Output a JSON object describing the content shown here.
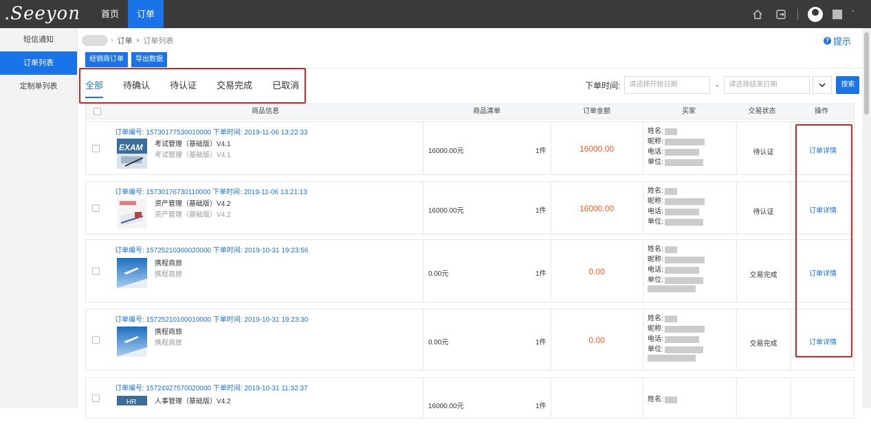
{
  "header": {
    "logo_text": ".Seeyon",
    "nav": [
      {
        "label": "首页",
        "active": false
      },
      {
        "label": "订单",
        "active": true
      }
    ]
  },
  "sidebar": {
    "items": [
      {
        "label": "短信通知",
        "active": false
      },
      {
        "label": "订单列表",
        "active": true
      },
      {
        "label": "定制单列表",
        "active": false
      }
    ]
  },
  "breadcrumb": {
    "parent": "订单",
    "separator": "›",
    "current": "订单列表"
  },
  "help_label": "提示",
  "actions": {
    "dealer_order": "经销商订单",
    "export": "导出数据"
  },
  "tabs": [
    {
      "label": "全部",
      "active": true
    },
    {
      "label": "待确认",
      "active": false
    },
    {
      "label": "待认证",
      "active": false
    },
    {
      "label": "交易完成",
      "active": false
    },
    {
      "label": "已取消",
      "active": false
    }
  ],
  "filter": {
    "label": "下单时间:",
    "start_placeholder": "请选择开始日期",
    "dash": "-",
    "end_placeholder": "请选择结束日期",
    "search_label": "搜索"
  },
  "table": {
    "columns": [
      "商品信息",
      "商品清单",
      "订单金额",
      "买家",
      "交易状态",
      "操作"
    ]
  },
  "buyer_labels": {
    "name": "姓名:",
    "nick": "昵称:",
    "phone": "电话:",
    "unit": "单位:"
  },
  "orders": [
    {
      "header": "订单编号: 15730177530010000 下单时间: 2019-11-06 13:22:33",
      "product": "考试管理（基础版）V4.1",
      "product_sub": "考试管理（基础版）V4.1",
      "price": "16000.00元",
      "qty": "1件",
      "amount": "16000.00",
      "status": "待认证",
      "action": "订单详情",
      "thumb": "exam"
    },
    {
      "header": "订单编号: 15730176730110000 下单时间: 2019-11-06 13:21:13",
      "product": "资产管理（基础版）V4.2",
      "product_sub": "资产管理（基础版）V4.2",
      "price": "16000.00元",
      "qty": "1件",
      "amount": "16000.00",
      "status": "待认证",
      "action": "订单详情",
      "thumb": "asset"
    },
    {
      "header": "订单编号: 15725210360020000 下单时间: 2019-10-31 19:23:56",
      "product": "携程商旅",
      "product_sub": "携程商旅",
      "price": "0.00元",
      "qty": "1件",
      "amount": "0.00",
      "status": "交易完成",
      "action": "订单详情",
      "thumb": "travel"
    },
    {
      "header": "订单编号: 15725210100010000 下单时间: 2019-10-31 19:23:30",
      "product": "携程商旅",
      "product_sub": "携程商旅",
      "price": "0.00元",
      "qty": "1件",
      "amount": "0.00",
      "status": "交易完成",
      "action": "订单详情",
      "thumb": "travel"
    },
    {
      "header": "订单编号: 15724927570020000 下单时间: 2019-10-31 11:32:37",
      "product": "人事管理（基础版）V4.2",
      "price": "16000.00元",
      "qty": "1件",
      "thumb": "hr"
    }
  ],
  "colors": {
    "accent": "#1a73e8",
    "amount": "#ff5a1f",
    "highlight": "#e02020",
    "topbar": "#3a3a3a"
  }
}
